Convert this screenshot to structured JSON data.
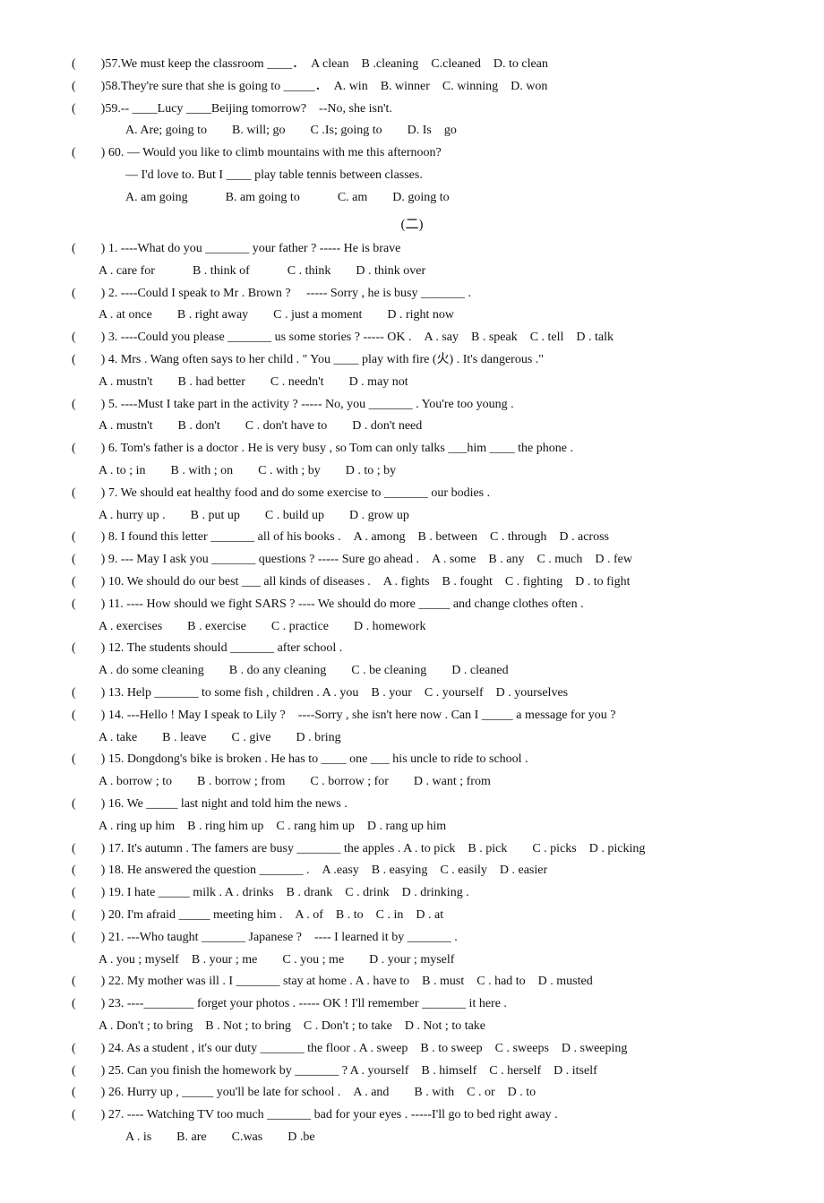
{
  "lines": [
    {
      "id": "q57",
      "text": "(　　)57.We must keep the classroom ____．　A clean　B .cleaning　C.cleaned　D. to clean"
    },
    {
      "id": "q58",
      "text": "(　　)58.They're sure that she is going to _____．　A. win　B. winner　C. winning　D. won"
    },
    {
      "id": "q59a",
      "text": "(　　)59.-- ____Lucy ____Beijing  tomorrow?　--No, she isn't."
    },
    {
      "id": "q59b",
      "indent": true,
      "text": "A. Are; going to　　B. will; go　　C .Is; going to　　D. Is　go"
    },
    {
      "id": "q60a",
      "text": "(　　) 60. — Would you like to climb mountains with me this afternoon?"
    },
    {
      "id": "q60b",
      "indent": true,
      "text": "— I'd love to. But I ____ play table tennis between classes."
    },
    {
      "id": "q60c",
      "indent": true,
      "text": "A. am going　　　B. am going to　　　C. am　　D. going to"
    },
    {
      "id": "section",
      "text": "(二)"
    },
    {
      "id": "q1a",
      "text": "(　　) 1. ----What do you _______ your father ? ----- He is brave"
    },
    {
      "id": "q1b",
      "text": "A . care for　　　B . think of　　　C . think　　D . think over"
    },
    {
      "id": "q2a",
      "text": "(　　) 2. ----Could I speak to Mr . Brown ? 　----- Sorry , he is busy _______ ."
    },
    {
      "id": "q2b",
      "text": "A . at once　　B . right away　　C . just a moment　　D . right now"
    },
    {
      "id": "q3a",
      "text": "(　　) 3. ----Could you please _______ us some stories ? ----- OK .　A . say　B . speak　C . tell　D . talk"
    },
    {
      "id": "q4a",
      "text": "(　　) 4. Mrs . Wang often says to her child . \" You ____ play with fire (火) . It's dangerous .\""
    },
    {
      "id": "q4b",
      "text": "A . mustn't　　B . had better　　C . needn't　　D . may not"
    },
    {
      "id": "q5a",
      "text": "(　　) 5. ----Must I take part in the activity ? ----- No, you _______ . You're too young ."
    },
    {
      "id": "q5b",
      "text": "A . mustn't　　B . don't　　C . don't have to　　D . don't need"
    },
    {
      "id": "q6a",
      "text": "(　　) 6. Tom's father is a doctor . He is very busy , so Tom can only talks ___him ____ the phone ."
    },
    {
      "id": "q6b",
      "text": "A . to ; in　　B . with ; on　　C . with ; by　　D . to ; by"
    },
    {
      "id": "q7a",
      "text": "(　　) 7. We should eat healthy food and do some exercise to _______ our bodies ."
    },
    {
      "id": "q7b",
      "text": "A . hurry up .　　B . put up　　C . build up　　D . grow up"
    },
    {
      "id": "q8a",
      "text": "(　　) 8. I found this letter _______ all of his books .　A . among　B . between　C . through　D . across"
    },
    {
      "id": "q9a",
      "text": "(　　) 9. --- May I ask you _______ questions ? ----- Sure go ahead .　A . some　B . any　C . much　D . few"
    },
    {
      "id": "q10a",
      "text": "(　　) 10. We should do our best ___ all kinds of diseases .　A . fights　B . fought　C . fighting　D . to fight"
    },
    {
      "id": "q11a",
      "text": "(　　) 11. ---- How should we fight SARS ? ---- We should do more _____ and change clothes often ."
    },
    {
      "id": "q11b",
      "text": "A . exercises　　B . exercise　　C . practice　　D . homework"
    },
    {
      "id": "q12a",
      "text": "(　　) 12. The students should _______ after school ."
    },
    {
      "id": "q12b",
      "text": "A . do some cleaning　　B . do any cleaning　　C . be cleaning　　D . cleaned"
    },
    {
      "id": "q13a",
      "text": "(　　) 13. Help _______ to some fish , children . A . you　B . your　C . yourself　D . yourselves"
    },
    {
      "id": "q14a",
      "text": "(　　) 14. ---Hello ! May I speak to Lily ?　----Sorry , she isn't here now . Can I _____ a message for you ?"
    },
    {
      "id": "q14b",
      "text": "A . take　　B . leave　　C . give　　D . bring"
    },
    {
      "id": "q15a",
      "text": "(　　) 15. Dongdong's bike is broken . He has to ____ one ___ his uncle to ride to school ."
    },
    {
      "id": "q15b",
      "text": "A . borrow ; to　　B . borrow ; from　　C . borrow ; for　　D . want ; from"
    },
    {
      "id": "q16a",
      "text": "(　　) 16. We _____ last night and told him the news ."
    },
    {
      "id": "q16b",
      "text": "A . ring up him　B . ring him up　C . rang him up　D . rang up him"
    },
    {
      "id": "q17a",
      "text": "(　　) 17. It's autumn . The famers are busy _______ the apples . A . to pick　B . pick　　C . picks　D . picking"
    },
    {
      "id": "q18a",
      "text": "(　　) 18. He answered the question _______ .　A .easy　B . easying　C . easily　D . easier"
    },
    {
      "id": "q19a",
      "text": "(　　) 19. I hate _____ milk . A . drinks　B . drank　C . drink　D . drinking ."
    },
    {
      "id": "q20a",
      "text": "(　　) 20. I'm afraid _____ meeting him .　A . of　B . to　C . in　D . at"
    },
    {
      "id": "q21a",
      "text": "(　　) 21. ---Who taught _______ Japanese ?　---- I learned it by _______ ."
    },
    {
      "id": "q21b",
      "text": "A . you ; myself　B . your ; me　　C . you ; me　　D . your ; myself"
    },
    {
      "id": "q22a",
      "text": "(　　) 22. My mother was ill . I _______ stay at home . A . have to　B . must　C . had to　D . musted"
    },
    {
      "id": "q23a",
      "text": "(　　) 23. ----________ forget your photos . ----- OK ! I'll remember _______ it here ."
    },
    {
      "id": "q23b",
      "text": "A . Don't ; to bring　B . Not ; to bring　C . Don't ; to take　D . Not ; to take"
    },
    {
      "id": "q24a",
      "text": "(　　) 24. As a student , it's our duty _______ the floor . A . sweep　B . to sweep　C . sweeps　D . sweeping"
    },
    {
      "id": "q25a",
      "text": "(　　) 25. Can you finish the homework by _______ ? A . yourself　B . himself　C . herself　D . itself"
    },
    {
      "id": "q26a",
      "text": "(　　) 26. Hurry up , _____ you'll be late for school .　A . and　　B . with　C . or　D . to"
    },
    {
      "id": "q27a",
      "text": "(　　) 27. ---- Watching TV too much _______ bad for your eyes . -----I'll go to bed right away ."
    },
    {
      "id": "q27b",
      "indent": true,
      "text": "A . is　　B. are　　C.was　　D .be"
    }
  ]
}
